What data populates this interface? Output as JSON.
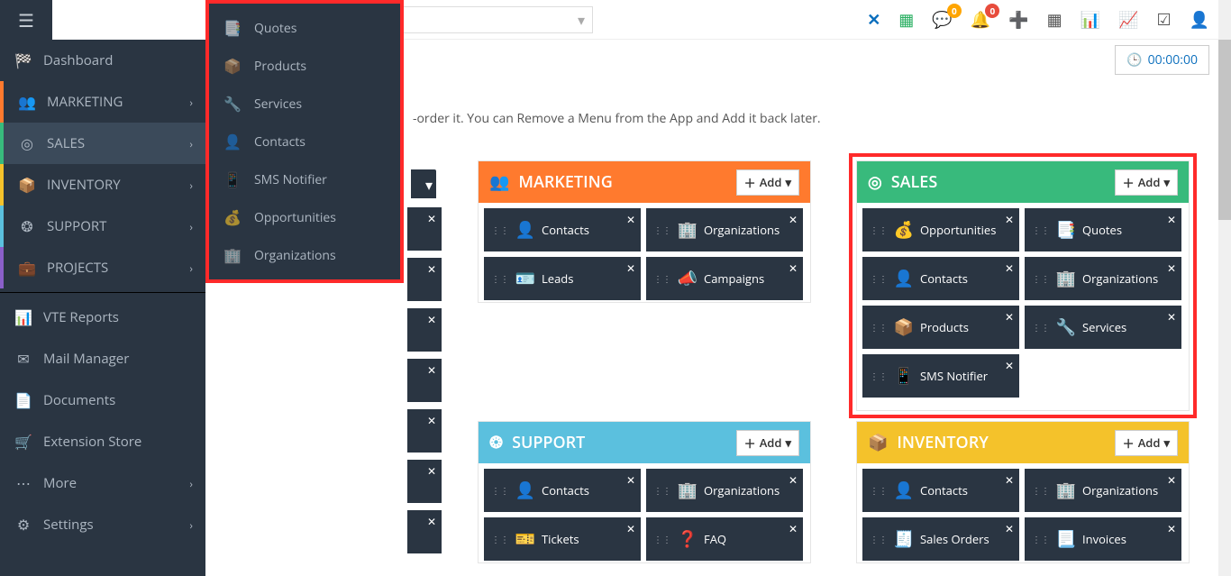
{
  "topbar": {
    "search_placeholder": ""
  },
  "timer": {
    "value": "00:00:00"
  },
  "helptext_suffix": "-order it. You can Remove a Menu from the App and Add it back later.",
  "sidebar": {
    "items": [
      {
        "label": "Dashboard"
      },
      {
        "label": "MARKETING"
      },
      {
        "label": "SALES"
      },
      {
        "label": "INVENTORY"
      },
      {
        "label": "SUPPORT"
      },
      {
        "label": "PROJECTS"
      }
    ],
    "secondary": [
      {
        "label": "VTE Reports"
      },
      {
        "label": "Mail Manager"
      },
      {
        "label": "Documents"
      },
      {
        "label": "Extension Store"
      },
      {
        "label": "More"
      },
      {
        "label": "Settings"
      }
    ],
    "submenu": [
      {
        "label": "Quotes"
      },
      {
        "label": "Products"
      },
      {
        "label": "Services"
      },
      {
        "label": "Contacts"
      },
      {
        "label": "SMS Notifier"
      },
      {
        "label": "Opportunities"
      },
      {
        "label": "Organizations"
      }
    ]
  },
  "panels": {
    "add_label": "Add",
    "marketing": {
      "title": "MARKETING",
      "cards": [
        "Contacts",
        "Organizations",
        "Leads",
        "Campaigns"
      ]
    },
    "sales": {
      "title": "SALES",
      "cards": [
        "Opportunities",
        "Quotes",
        "Contacts",
        "Organizations",
        "Products",
        "Services",
        "SMS Notifier"
      ]
    },
    "support": {
      "title": "SUPPORT",
      "cards": [
        "Contacts",
        "Organizations",
        "Tickets",
        "FAQ"
      ]
    },
    "inventory": {
      "title": "INVENTORY",
      "cards": [
        "Contacts",
        "Organizations",
        "Sales Orders",
        "Invoices"
      ]
    }
  }
}
